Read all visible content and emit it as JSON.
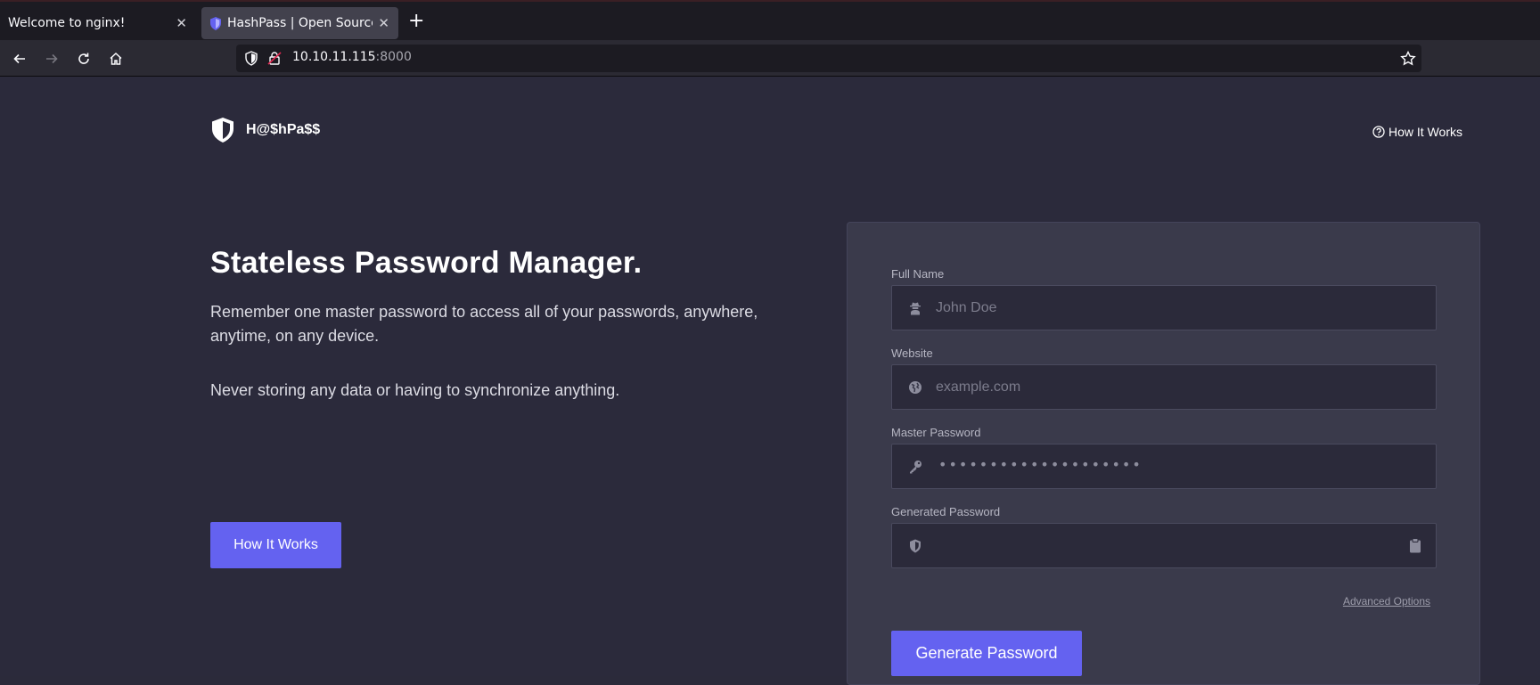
{
  "browser": {
    "tabs": [
      {
        "title": "Welcome to nginx!",
        "active": false
      },
      {
        "title": "HashPass | Open Source",
        "active": true
      }
    ],
    "new_tab_label": "+",
    "url_host": "10.10.11.115",
    "url_port": ":8000"
  },
  "header": {
    "brand": "H@$hPa$$",
    "nav_link": "How It Works"
  },
  "hero": {
    "title": "Stateless Password Manager.",
    "paragraph1": "Remember one master password to access all of your passwords, anywhere, anytime, on any device.",
    "paragraph2": "Never storing any data or having to synchronize anything.",
    "button": "How It Works"
  },
  "form": {
    "full_name": {
      "label": "Full Name",
      "placeholder": "John Doe"
    },
    "website": {
      "label": "Website",
      "placeholder": "example.com"
    },
    "master_password": {
      "label": "Master Password",
      "value": "••••••••••••••••••••"
    },
    "generated_password": {
      "label": "Generated Password",
      "value": ""
    },
    "advanced_options": "Advanced Options",
    "submit": "Generate Password"
  },
  "colors": {
    "accent": "#6462f0",
    "page_bg": "#2b2a3b",
    "card_bg": "#3a3a4b"
  }
}
